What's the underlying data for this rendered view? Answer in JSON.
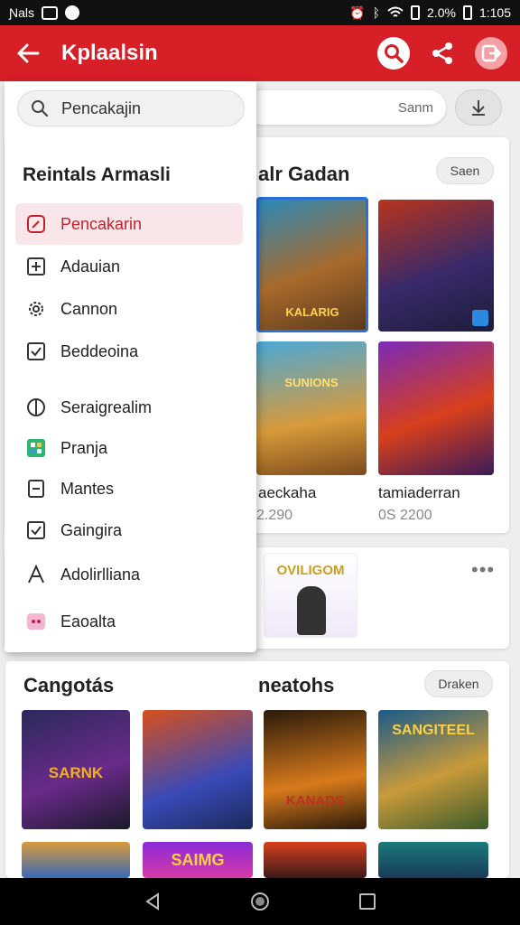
{
  "status_bar": {
    "left_text": "Ɲals",
    "right_text": "2.0%",
    "time": "1:105"
  },
  "app_bar": {
    "title": "Kplaalsin",
    "accent": "#d71f27"
  },
  "background": {
    "search_text": "Sanm",
    "section1": {
      "title": "alr Gadan",
      "pill": "Saen",
      "tiles": [
        {
          "label": "",
          "price": ""
        },
        {
          "label": "",
          "price": ""
        },
        {
          "label": "aeckaha",
          "price": "2.290"
        },
        {
          "label": "tamiaderran",
          "price": "0S 2200"
        }
      ]
    },
    "section2": {
      "banner": "OVILIGOM",
      "more": "•••"
    },
    "section3": {
      "title_left": "Cangotás",
      "title_right": "neatohs",
      "pill": "Draken",
      "tile_texts": [
        "SARNK",
        "",
        "KANADS",
        "SANGITEEL"
      ],
      "tile_texts_row2": [
        "",
        "SAIMG",
        "",
        ""
      ]
    },
    "tile_captions": {
      "t1": "KALARIG",
      "t2": "SUNIONS"
    }
  },
  "drawer": {
    "search_placeholder": "Pencakajin",
    "heading": "Reintals Armasli",
    "items": [
      {
        "label": "Pencakarin",
        "icon": "edit-icon",
        "active": true
      },
      {
        "label": "Adauian",
        "icon": "plus-square-icon",
        "active": false
      },
      {
        "label": "Cannon",
        "icon": "gear-icon",
        "active": false
      },
      {
        "label": "Beddeoina",
        "icon": "checkbox-icon",
        "active": false
      },
      {
        "label": "Seraigrealim",
        "icon": "half-circle-icon",
        "active": false
      },
      {
        "label": "Pranja",
        "icon": "app-grid-icon",
        "active": false
      },
      {
        "label": "Mantes",
        "icon": "minus-square-icon",
        "active": false
      },
      {
        "label": "Gaingira",
        "icon": "checkbox-icon",
        "active": false
      },
      {
        "label": "Adolirlliana",
        "icon": "a-icon",
        "active": false
      },
      {
        "label": "Eaoalta",
        "icon": "pink-square-icon",
        "active": false
      }
    ]
  }
}
